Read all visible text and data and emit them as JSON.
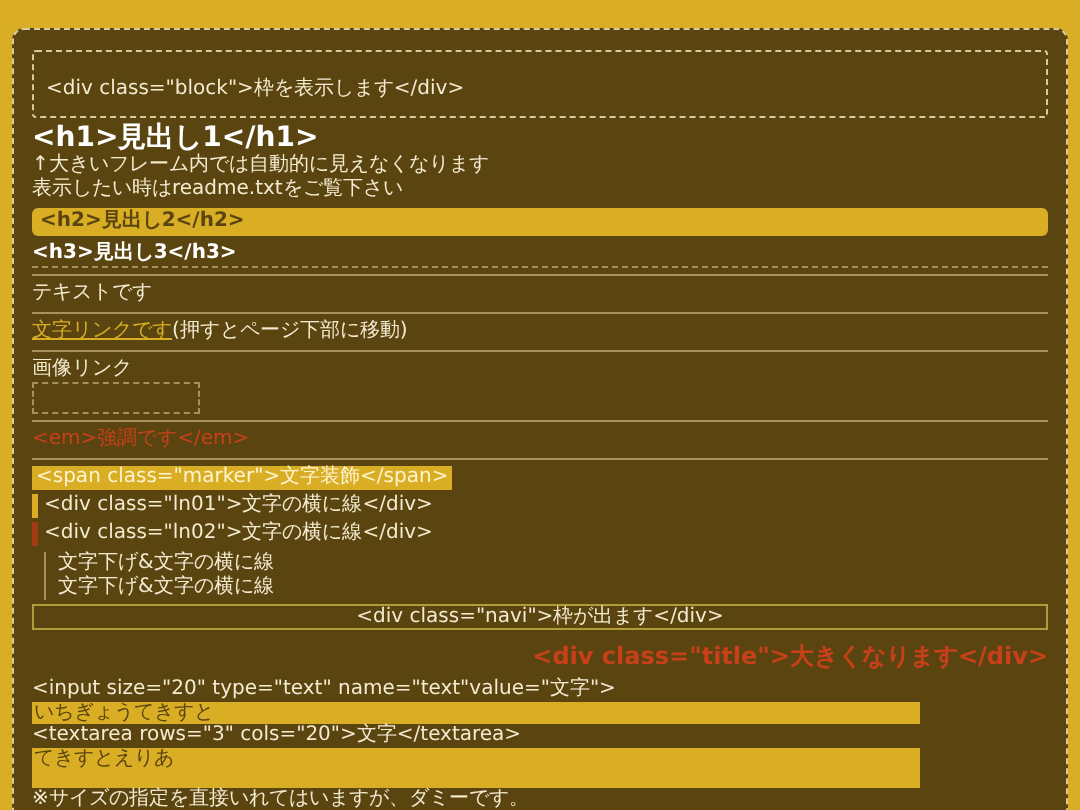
{
  "block": {
    "text": "<div class=\"block\">枠を表示します</div>"
  },
  "h1": {
    "text": "<h1>見出し1</h1>",
    "notes": [
      "↑大きいフレーム内では自動的に見えなくなります",
      "表示したい時はreadme.txtをご覧下さい"
    ]
  },
  "h2": {
    "text": "<h2>見出し2</h2>"
  },
  "h3": {
    "text": "<h3>見出し3</h3>"
  },
  "paragraph": "テキストです",
  "link_line": {
    "link": "文字リンクです",
    "note": "(押すとページ下部に移動)"
  },
  "image_link": {
    "label": "画像リンク"
  },
  "em": "<em>強調です</em>",
  "marker": "<span class=\"marker\">文字装飾</span>",
  "side_lines": [
    {
      "text": "<div class=\"ln01\">文字の横に線</div>",
      "color": "#d9ad24"
    },
    {
      "text": "<div class=\"ln02\">文字の横に線</div>",
      "color": "#a33a12"
    }
  ],
  "indent_lines": [
    "文字下げ&文字の横に線",
    "文字下げ&文字の横に線"
  ],
  "navi": "<div class=\"navi\">枠が出ます</div>",
  "title": "<div class=\"title\">大きくなります</div>",
  "form": {
    "input_label": "<input size=\"20\" type=\"text\" name=\"text\"value=\"文字\">",
    "input_value": "いちぎょうてきすと",
    "textarea_label": "<textarea rows=\"3\" cols=\"20\">文字</textarea>",
    "textarea_value": "てきすとえりあ",
    "note": "※サイズの指定を直接いれてはいますが、ダミーです。"
  }
}
